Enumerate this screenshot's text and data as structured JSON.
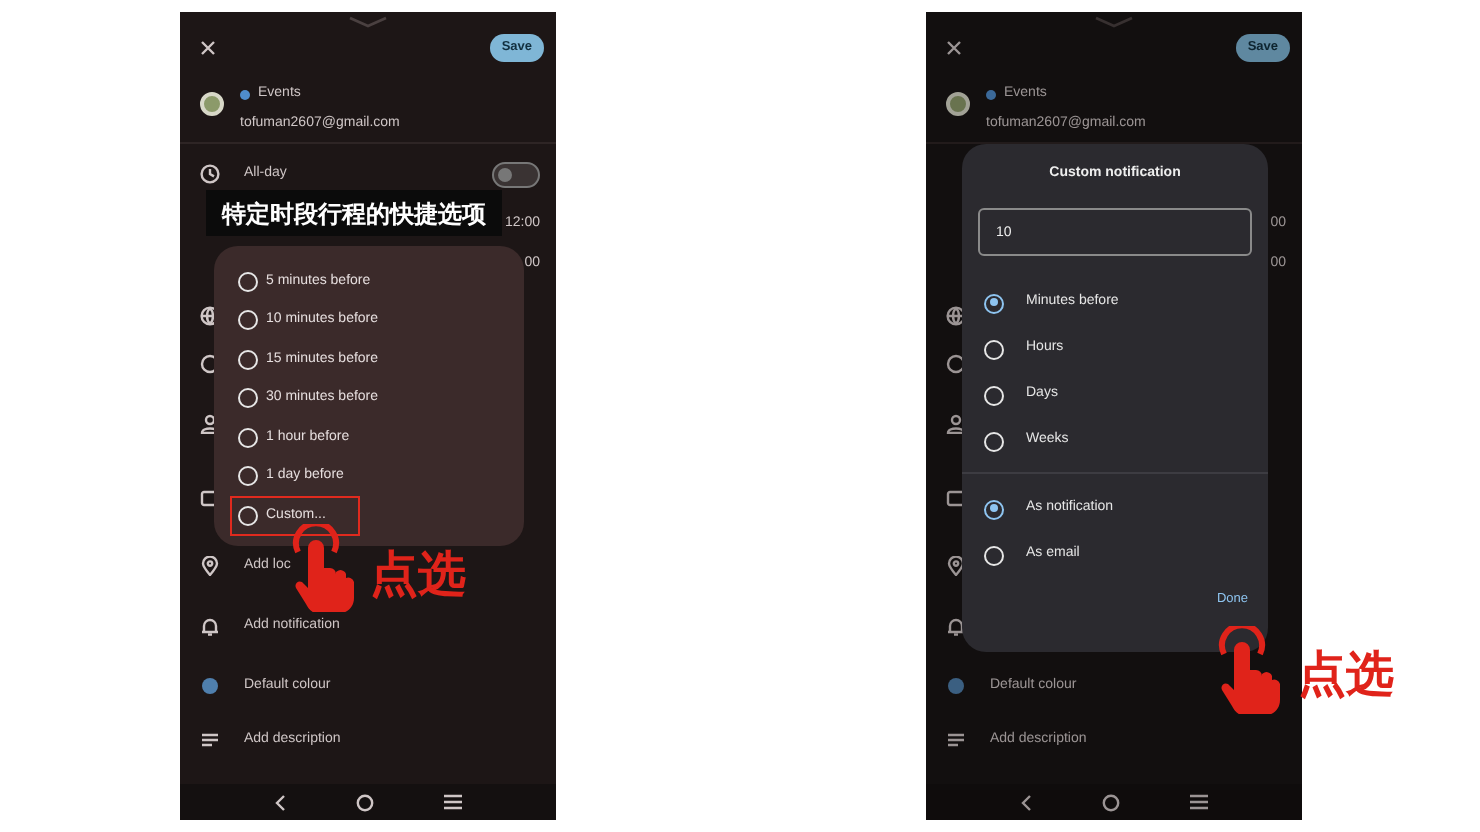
{
  "screens": [
    {
      "header": {
        "save": "Save"
      },
      "account": {
        "calendar": "Events",
        "email": "tofuman2607@gmail.com"
      },
      "all_day": {
        "label": "All-day",
        "on": false
      },
      "times": [
        "12:00",
        "00"
      ],
      "rows": [
        {
          "kind": "timezone"
        },
        {
          "kind": "repeat"
        },
        {
          "kind": "people"
        },
        {
          "kind": "video"
        },
        {
          "kind": "location",
          "label": "Add loc"
        },
        {
          "kind": "notification",
          "label": "Add notification"
        },
        {
          "kind": "colour",
          "label": "Default colour"
        },
        {
          "kind": "description",
          "label": "Add description"
        }
      ],
      "caption": "特定时段行程的快捷选项",
      "dialog": {
        "kind": "quick",
        "options": [
          {
            "label": "5 minutes before",
            "selected": false,
            "highlighted": false
          },
          {
            "label": "10 minutes before",
            "selected": false,
            "highlighted": false
          },
          {
            "label": "15 minutes before",
            "selected": false,
            "highlighted": false
          },
          {
            "label": "30 minutes before",
            "selected": false,
            "highlighted": false
          },
          {
            "label": "1 hour before",
            "selected": false,
            "highlighted": false
          },
          {
            "label": "1 day before",
            "selected": false,
            "highlighted": false
          },
          {
            "label": "Custom...",
            "selected": false,
            "highlighted": true
          }
        ]
      },
      "tap": {
        "label": "点选"
      }
    },
    {
      "header": {
        "save": "Save"
      },
      "account": {
        "calendar": "Events",
        "email": "tofuman2607@gmail.com"
      },
      "times": [
        "00",
        "00"
      ],
      "rows": [
        {
          "kind": "timezone"
        },
        {
          "kind": "repeat"
        },
        {
          "kind": "people"
        },
        {
          "kind": "video"
        },
        {
          "kind": "location"
        },
        {
          "kind": "notification"
        },
        {
          "kind": "colour",
          "label": "Default colour"
        },
        {
          "kind": "description",
          "label": "Add description"
        }
      ],
      "dialog": {
        "kind": "custom",
        "title": "Custom notification",
        "value": "10",
        "units": [
          {
            "label": "Minutes before",
            "selected": true
          },
          {
            "label": "Hours",
            "selected": false
          },
          {
            "label": "Days",
            "selected": false
          },
          {
            "label": "Weeks",
            "selected": false
          }
        ],
        "methods": [
          {
            "label": "As notification",
            "selected": true
          },
          {
            "label": "As email",
            "selected": false
          }
        ],
        "done": "Done"
      },
      "tap": {
        "label": "点选"
      }
    }
  ]
}
